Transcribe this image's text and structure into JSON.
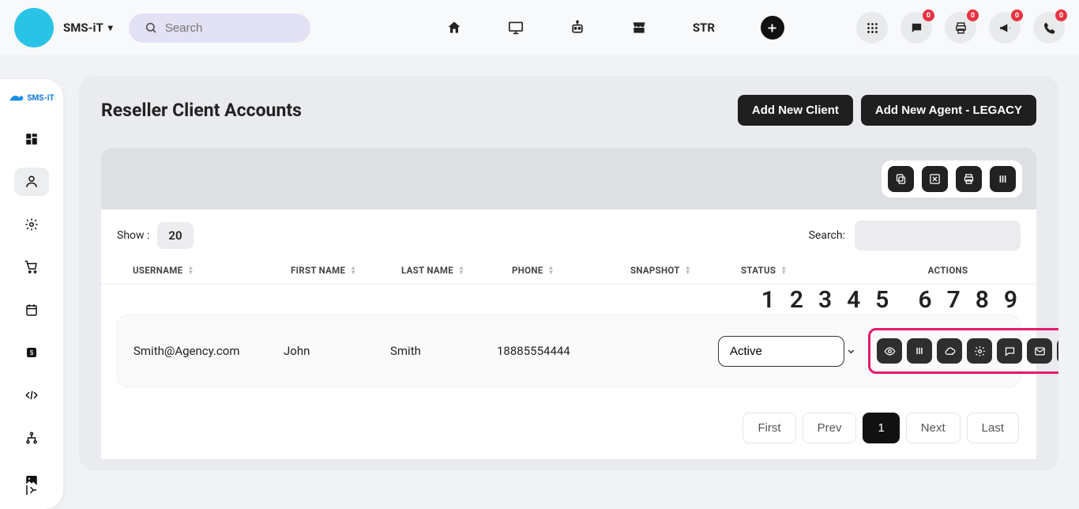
{
  "header": {
    "brand": "SMS-iT",
    "search_placeholder": "Search",
    "str_label": "STR",
    "badges": {
      "chat": "0",
      "print": "0",
      "bullhorn": "0",
      "phone": "0"
    }
  },
  "sidebar": {
    "logo_text": "SMS-iT"
  },
  "page": {
    "title": "Reseller Client Accounts",
    "add_client": "Add New Client",
    "add_agent": "Add New Agent - LEGACY"
  },
  "table": {
    "show_label": "Show :",
    "show_value": "20",
    "search_label": "Search:",
    "columns": {
      "username": "USERNAME",
      "firstname": "FIRST NAME",
      "lastname": "LAST NAME",
      "phone": "PHONE",
      "snapshot": "SNAPSHOT",
      "status": "STATUS",
      "actions": "ACTIONS"
    },
    "row": {
      "username": "Smith@Agency.com",
      "firstname": "John",
      "lastname": "Smith",
      "phone": "18885554444",
      "snapshot": "",
      "status": "Active"
    },
    "annotation_numbers": [
      "1",
      "2",
      "3",
      "4",
      "5",
      "6",
      "7",
      "8",
      "9"
    ]
  },
  "pager": {
    "first": "First",
    "prev": "Prev",
    "current": "1",
    "next": "Next",
    "last": "Last"
  }
}
